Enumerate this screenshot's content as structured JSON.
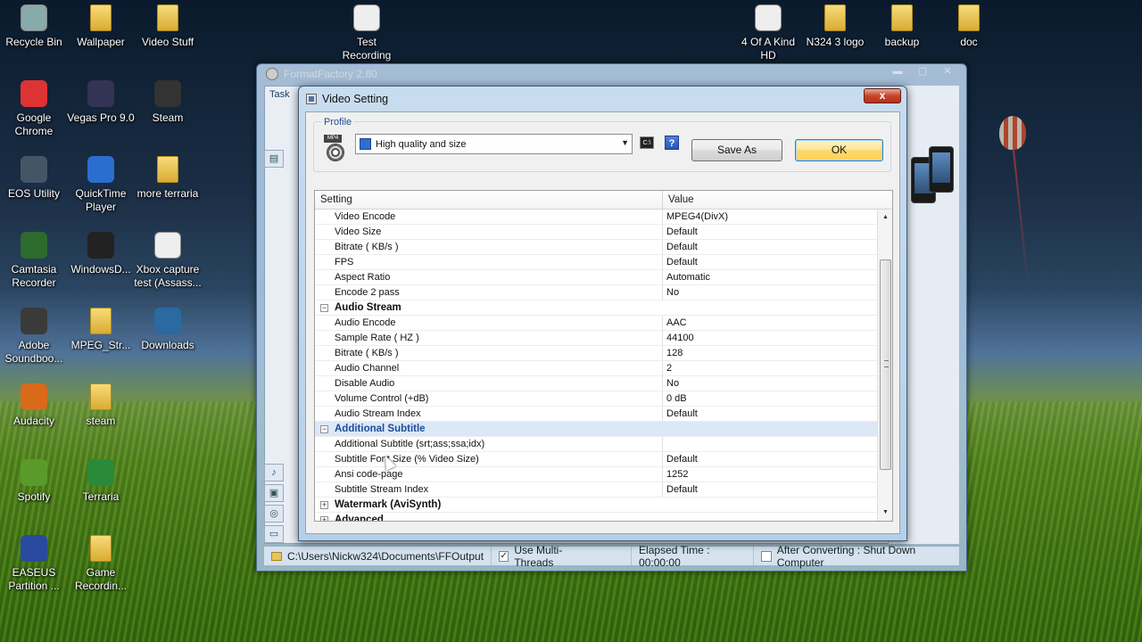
{
  "desktop": {
    "icons": [
      {
        "label": "Recycle Bin",
        "icon": "recycle-bin-icon"
      },
      {
        "label": "Wallpaper",
        "icon": "folder-icon"
      },
      {
        "label": "Video Stuff",
        "icon": "folder-icon"
      },
      {
        "label": "Test\nRecording",
        "icon": "avi-file-icon"
      },
      {
        "label": "4 Of A Kind\nHD",
        "icon": "mpeg4-file-icon"
      },
      {
        "label": "N324 3 logo",
        "icon": "folder-icon"
      },
      {
        "label": "backup",
        "icon": "folder-icon"
      },
      {
        "label": "doc",
        "icon": "folder-icon"
      },
      {
        "label": "Google\nChrome",
        "icon": "chrome-icon"
      },
      {
        "label": "Vegas Pro 9.0",
        "icon": "vegas-icon"
      },
      {
        "label": "Steam",
        "icon": "steam-icon"
      },
      {
        "label": "EOS Utility",
        "icon": "eos-utility-icon"
      },
      {
        "label": "QuickTime\nPlayer",
        "icon": "quicktime-icon"
      },
      {
        "label": "more terraria",
        "icon": "folder-icon"
      },
      {
        "label": "Camtasia\nRecorder",
        "icon": "camtasia-icon"
      },
      {
        "label": "WindowsD...",
        "icon": "windows-dvd-icon"
      },
      {
        "label": "Xbox capture\ntest (Assass...",
        "icon": "mpeg4-file-icon"
      },
      {
        "label": "Adobe\nSoundboo...",
        "icon": "soundbooth-icon"
      },
      {
        "label": "MPEG_Str...",
        "icon": "folder-icon"
      },
      {
        "label": "Downloads",
        "icon": "downloads-icon"
      },
      {
        "label": "Audacity",
        "icon": "audacity-icon"
      },
      {
        "label": "steam",
        "icon": "folder-icon"
      },
      {
        "label": "Spotify",
        "icon": "spotify-icon"
      },
      {
        "label": "Terraria",
        "icon": "terraria-icon"
      },
      {
        "label": "EASEUS\nPartition ...",
        "icon": "easeus-icon"
      },
      {
        "label": "Game\nRecordin...",
        "icon": "folder-icon"
      }
    ]
  },
  "main_window": {
    "title": "FormatFactory 2.80",
    "tab_label": "Task",
    "status": {
      "output_path": "C:\\Users\\Nickw324\\Documents\\FFOutput",
      "multi_threads_label": "Use Multi-Threads",
      "elapsed": "Elapsed Time : 00:00:00",
      "after_converting": "After Converting : Shut Down Computer"
    }
  },
  "dialog": {
    "title": "Video Setting",
    "close_label": "x",
    "profile_legend": "Profile",
    "profile_icon_tag": "MP4",
    "profile_value": "High quality and size",
    "cmd_label": "C:\\",
    "help_label": "?",
    "save_as_label": "Save As",
    "ok_label": "OK",
    "grid": {
      "col_setting": "Setting",
      "col_value": "Value",
      "rows": [
        {
          "type": "prop",
          "name": "Video Encode",
          "value": "MPEG4(DivX)"
        },
        {
          "type": "prop",
          "name": "Video Size",
          "value": "Default"
        },
        {
          "type": "prop",
          "name": "Bitrate ( KB/s )",
          "value": "Default"
        },
        {
          "type": "prop",
          "name": "FPS",
          "value": "Default"
        },
        {
          "type": "prop",
          "name": "Aspect Ratio",
          "value": "Automatic"
        },
        {
          "type": "prop",
          "name": "Encode 2 pass",
          "value": "No"
        },
        {
          "type": "cat",
          "name": "Audio Stream",
          "toggle": "−"
        },
        {
          "type": "prop",
          "name": "Audio Encode",
          "value": "AAC"
        },
        {
          "type": "prop",
          "name": "Sample Rate ( HZ )",
          "value": "44100"
        },
        {
          "type": "prop",
          "name": "Bitrate ( KB/s )",
          "value": "128"
        },
        {
          "type": "prop",
          "name": "Audio Channel",
          "value": "2"
        },
        {
          "type": "prop",
          "name": "Disable Audio",
          "value": "No"
        },
        {
          "type": "prop",
          "name": "Volume Control (+dB)",
          "value": "0 dB"
        },
        {
          "type": "prop",
          "name": "Audio Stream Index",
          "value": "Default"
        },
        {
          "type": "cat",
          "name": "Additional Subtitle",
          "toggle": "−",
          "selected": true
        },
        {
          "type": "prop",
          "name": "Additional Subtitle (srt;ass;ssa;idx)",
          "value": ""
        },
        {
          "type": "prop",
          "name": "Subtitle Font Size (% Video Size)",
          "value": "Default"
        },
        {
          "type": "prop",
          "name": "Ansi code-page",
          "value": "1252"
        },
        {
          "type": "prop",
          "name": "Subtitle Stream Index",
          "value": "Default"
        },
        {
          "type": "cat",
          "name": "Watermark (AviSynth)",
          "toggle": "+"
        },
        {
          "type": "cat",
          "name": "Advanced",
          "toggle": "+"
        }
      ]
    }
  }
}
